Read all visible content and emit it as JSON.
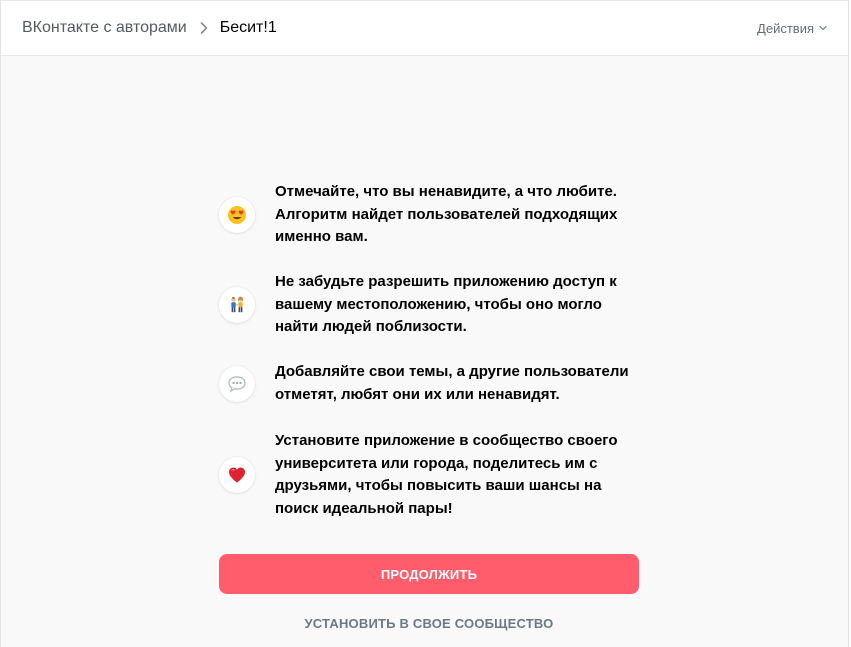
{
  "header": {
    "breadcrumb_root": "ВКонтакте с авторами",
    "breadcrumb_current": "Бесит!1",
    "actions_label": "Действия"
  },
  "features": [
    {
      "icon": "heart-eyes-emoji-icon",
      "text": "Отмечайте, что вы ненавидите, а что любите. Алгоритм найдет пользователей подходящих именно вам."
    },
    {
      "icon": "couple-emoji-icon",
      "text": "Не забудьте разрешить приложению доступ к вашему местоположению, чтобы оно могло найти людей поблизости."
    },
    {
      "icon": "speech-bubble-icon",
      "text": "Добавляйте свои темы, а другие пользователи отметят, любят они их или ненавидят."
    },
    {
      "icon": "red-heart-icon",
      "text": "Установите приложение в сообщество своего университета или города, поделитесь им с друзьями, чтобы повысить ваши шансы на поиск идеальной пары!"
    }
  ],
  "buttons": {
    "primary_label": "ПРОДОЛЖИТЬ",
    "secondary_label": "УСТАНОВИТЬ В СВОЕ СООБЩЕСТВО"
  },
  "colors": {
    "primary_button": "#ff5c6c",
    "secondary_text": "#6d7885",
    "background": "#f9f9f9"
  }
}
